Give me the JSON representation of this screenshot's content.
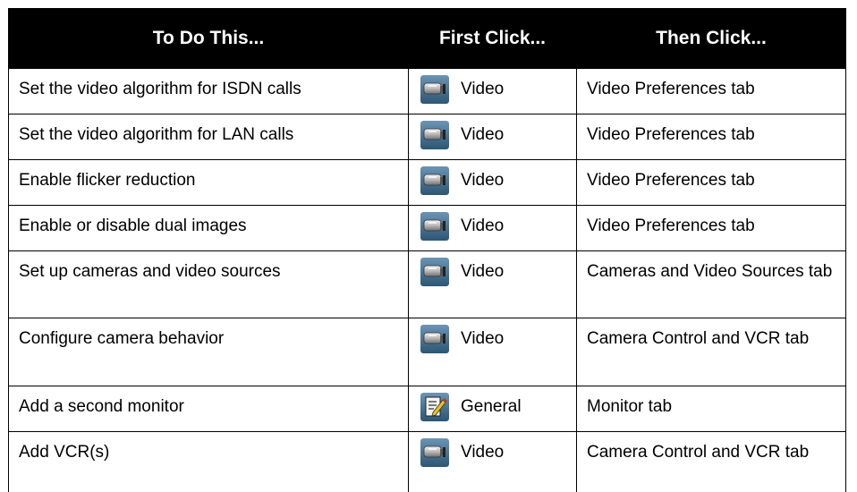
{
  "headers": {
    "col1": "To Do This...",
    "col2": "First Click...",
    "col3": "Then Click..."
  },
  "rows": [
    {
      "task": "Set the video algorithm for ISDN calls",
      "icon": "video-camera-icon",
      "first": "Video",
      "then": "Video Preferences tab"
    },
    {
      "task": "Set the video algorithm for LAN calls",
      "icon": "video-camera-icon",
      "first": "Video",
      "then": "Video Preferences tab"
    },
    {
      "task": "Enable flicker reduction",
      "icon": "video-camera-icon",
      "first": "Video",
      "then": "Video Preferences tab"
    },
    {
      "task": "Enable or disable dual images",
      "icon": "video-camera-icon",
      "first": "Video",
      "then": "Video Preferences tab"
    },
    {
      "task": "Set up cameras and video sources",
      "icon": "video-camera-icon",
      "first": "Video",
      "then": "Cameras and Video Sources tab"
    },
    {
      "task": "Configure camera behavior",
      "icon": "video-camera-icon",
      "first": "Video",
      "then": "Camera Control and VCR tab"
    },
    {
      "task": "Add a second monitor",
      "icon": "general-settings-icon",
      "first": "General",
      "then": "Monitor tab"
    },
    {
      "task": "Add VCR(s)",
      "icon": "video-camera-icon",
      "first": "Video",
      "then": "Camera Control and VCR tab"
    }
  ],
  "colors": {
    "header_bg": "#000000",
    "header_text": "#ffffff",
    "icon_bg": "#3f6e8e"
  }
}
